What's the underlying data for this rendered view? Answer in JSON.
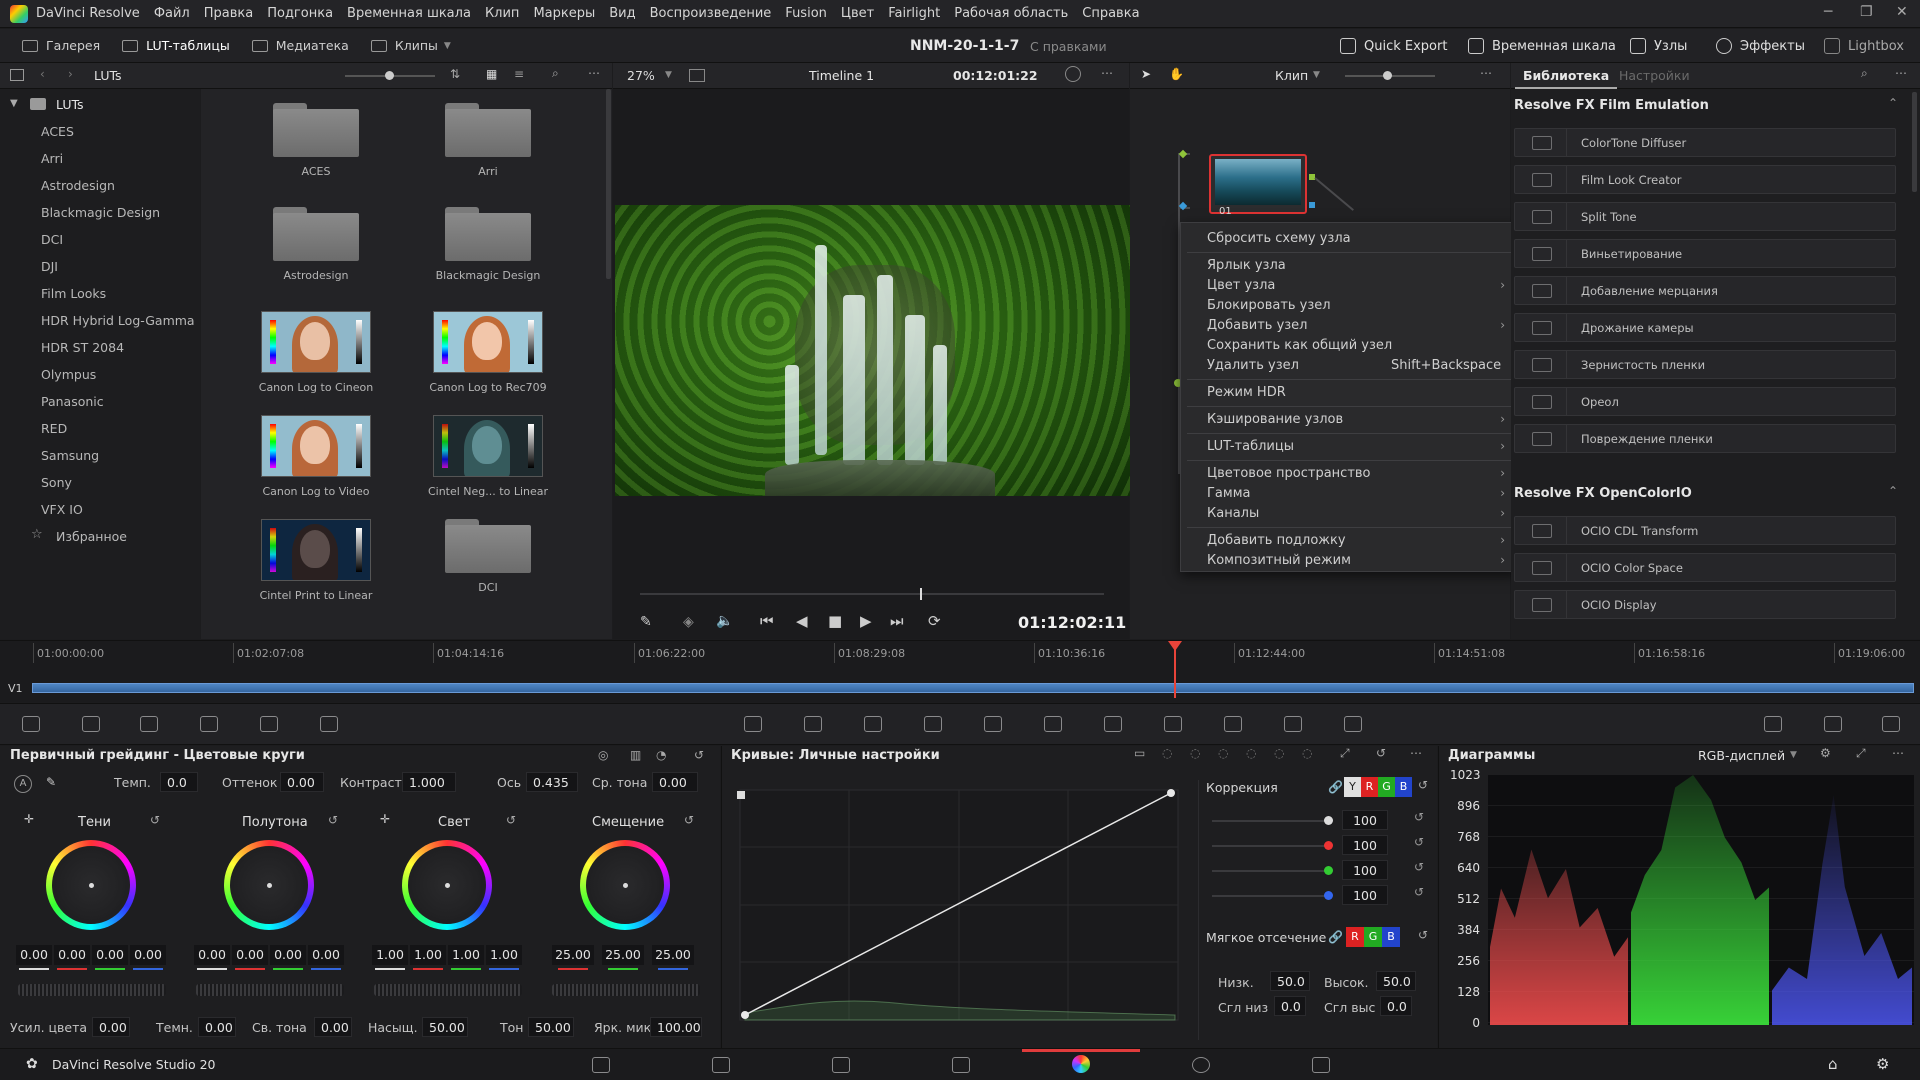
{
  "menu": [
    "DaVinci Resolve",
    "Файл",
    "Правка",
    "Подгонка",
    "Временная шкала",
    "Клип",
    "Маркеры",
    "Вид",
    "Воспроизведение",
    "Fusion",
    "Цвет",
    "Fairlight",
    "Рабочая область",
    "Справка"
  ],
  "toolbar": {
    "left": [
      {
        "label": "Галерея",
        "icon": "gallery-icon"
      },
      {
        "label": "LUT-таблицы",
        "icon": "lut-icon"
      },
      {
        "label": "Медиатека",
        "icon": "media-icon"
      },
      {
        "label": "Клипы",
        "icon": "clips-icon"
      }
    ],
    "project": "NNM-20-1-1-7",
    "project_status": "С правками",
    "right": [
      {
        "label": "Quick Export",
        "icon": "export-icon"
      },
      {
        "label": "Временная шкала",
        "icon": "timeline-icon"
      },
      {
        "label": "Узлы",
        "icon": "nodes-icon"
      },
      {
        "label": "Эффекты",
        "icon": "fx-icon"
      },
      {
        "label": "Lightbox",
        "icon": "lightbox-icon"
      }
    ]
  },
  "lut_panel": {
    "title": "LUTs",
    "root": "LUTs",
    "tree": [
      "ACES",
      "Arri",
      "Astrodesign",
      "Blackmagic Design",
      "DCI",
      "DJI",
      "Film Looks",
      "HDR Hybrid Log-Gamma",
      "HDR ST 2084",
      "Olympus",
      "Panasonic",
      "RED",
      "Samsung",
      "Sony",
      "VFX IO"
    ],
    "favorites": "Избранное",
    "grid": [
      {
        "label": "ACES",
        "kind": "folder"
      },
      {
        "label": "Arri",
        "kind": "folder"
      },
      {
        "label": "Astrodesign",
        "kind": "folder"
      },
      {
        "label": "Blackmagic Design",
        "kind": "folder"
      },
      {
        "label": "Canon Log to Cineon",
        "kind": "thumb"
      },
      {
        "label": "Canon Log to Rec709",
        "kind": "thumb"
      },
      {
        "label": "Canon Log to Video",
        "kind": "thumb"
      },
      {
        "label": "Cintel Neg... to Linear",
        "kind": "thumb-dark"
      },
      {
        "label": "Cintel Print to Linear",
        "kind": "thumb-blue"
      },
      {
        "label": "DCI",
        "kind": "folder"
      }
    ]
  },
  "viewer": {
    "zoom": "27%",
    "timeline_name": "Timeline 1",
    "timecode_top": "00:12:01:22",
    "timecode": "01:12:02:11"
  },
  "nodes": {
    "mode": "Клип",
    "node_label": "01"
  },
  "context_menu": {
    "items": [
      {
        "label": "Сбросить схему узла",
        "arrow": false
      },
      {
        "label": "Ярлык узла",
        "arrow": false
      },
      {
        "label": "Цвет узла",
        "arrow": true
      },
      {
        "label": "Блокировать узел",
        "arrow": false
      },
      {
        "label": "Добавить узел",
        "arrow": true
      },
      {
        "label": "Сохранить как общий узел",
        "arrow": false
      },
      {
        "label": "Удалить узел",
        "arrow": false,
        "shortcut": "Shift+Backspace"
      },
      {
        "label": "Режим HDR",
        "arrow": false
      },
      {
        "label": "Кэширование узлов",
        "arrow": true
      },
      {
        "label": "LUT-таблицы",
        "arrow": true
      },
      {
        "label": "Цветовое пространство",
        "arrow": true
      },
      {
        "label": "Гамма",
        "arrow": true
      },
      {
        "label": "Каналы",
        "arrow": true
      },
      {
        "label": "Добавить подложку",
        "arrow": true
      },
      {
        "label": "Композитный режим",
        "arrow": true
      }
    ]
  },
  "library": {
    "tabs": [
      "Библиотека",
      "Настройки"
    ],
    "group1": "Resolve FX Film Emulation",
    "group1_items": [
      "ColorTone Diffuser",
      "Film Look Creator",
      "Split Tone",
      "Виньетирование",
      "Добавление мерцания",
      "Дрожание камеры",
      "Зернистость пленки",
      "Ореол",
      "Повреждение пленки"
    ],
    "group2": "Resolve FX OpenColorIO",
    "group2_items": [
      "OCIO CDL Transform",
      "OCIO Color Space",
      "OCIO Display"
    ]
  },
  "timeline": {
    "track": "V1",
    "ticks": [
      "01:00:00:00",
      "01:02:07:08",
      "01:04:14:16",
      "01:06:22:00",
      "01:08:29:08",
      "01:10:36:16",
      "01:12:44:00",
      "01:14:51:08",
      "01:16:58:16",
      "01:19:06:00"
    ]
  },
  "primaries": {
    "title": "Первичный грейдинг - Цветовые круги",
    "top_params": [
      {
        "label": "Темп.",
        "value": "0.0"
      },
      {
        "label": "Оттенок",
        "value": "0.00"
      },
      {
        "label": "Контраст",
        "value": "1.000"
      },
      {
        "label": "Ось",
        "value": "0.435"
      },
      {
        "label": "Ср. тона",
        "value": "0.00"
      }
    ],
    "wheels": [
      {
        "name": "Тени",
        "values": [
          "0.00",
          "0.00",
          "0.00",
          "0.00"
        ]
      },
      {
        "name": "Полутона",
        "values": [
          "0.00",
          "0.00",
          "0.00",
          "0.00"
        ]
      },
      {
        "name": "Свет",
        "values": [
          "1.00",
          "1.00",
          "1.00",
          "1.00"
        ]
      },
      {
        "name": "Смещение",
        "values": [
          "25.00",
          "25.00",
          "25.00"
        ]
      }
    ],
    "bottom_params": [
      {
        "label": "Усил. цвета",
        "value": "0.00"
      },
      {
        "label": "Темн.",
        "value": "0.00"
      },
      {
        "label": "Св. тона",
        "value": "0.00"
      },
      {
        "label": "Насыщ.",
        "value": "50.00"
      },
      {
        "label": "Тон",
        "value": "50.00"
      },
      {
        "label": "Ярк. микс",
        "value": "100.00"
      }
    ]
  },
  "curves": {
    "title": "Кривые: Личные настройки",
    "correction_label": "Коррекция",
    "channels": [
      "Y",
      "R",
      "G",
      "B"
    ],
    "gains": [
      "100",
      "100",
      "100",
      "100"
    ],
    "soft_clip_label": "Мягкое отсечение",
    "soft_channels": [
      "R",
      "G",
      "B"
    ],
    "low_label": "Низк.",
    "low": "50.0",
    "high_label": "Высок.",
    "high": "50.0",
    "lsoft_label": "Сгл низ",
    "lsoft": "0.0",
    "hsoft_label": "Сгл выс",
    "hsoft": "0.0"
  },
  "scopes": {
    "title": "Диаграммы",
    "mode": "RGB-дисплей",
    "y_labels": [
      "1023",
      "896",
      "768",
      "640",
      "512",
      "384",
      "256",
      "128",
      "0"
    ]
  },
  "footer": {
    "app": "DaVinci Resolve Studio 20"
  },
  "colors": {
    "accent_red": "#e03c3c",
    "playhead": "#e8443a",
    "selection_blue": "#4a88d8"
  }
}
